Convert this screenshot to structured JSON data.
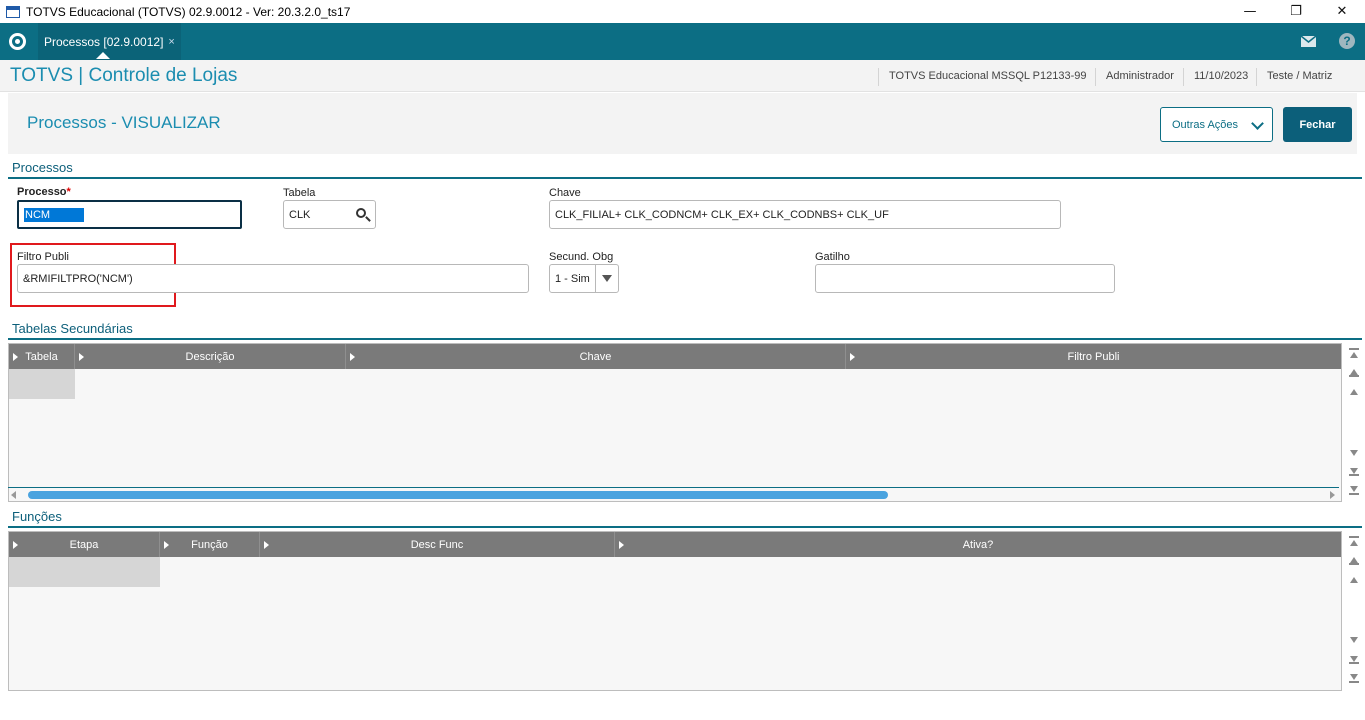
{
  "window": {
    "title": "TOTVS Educacional (TOTVS) 02.9.0012 - Ver: 20.3.2.0_ts17",
    "minimize": "—",
    "restore": "❐",
    "close": "✕"
  },
  "tabbar": {
    "tab_label": "Processos [02.9.0012]",
    "tab_close": "×",
    "help": "?"
  },
  "header": {
    "app_title": "TOTVS | Controle de Lojas",
    "environment": "TOTVS Educacional MSSQL P12133-99",
    "user": "Administrador",
    "date": "11/10/2023",
    "branch": "Teste / Matriz"
  },
  "page": {
    "title": "Processos - VISUALIZAR",
    "outras_acoes_label": "Outras Ações",
    "fechar_label": "Fechar"
  },
  "processos": {
    "section_title": "Processos",
    "processo_label": "Processo",
    "processo_required": "*",
    "processo_value": "NCM",
    "tabela_label": "Tabela",
    "tabela_value": "CLK",
    "chave_label": "Chave",
    "chave_value": "CLK_FILIAL+ CLK_CODNCM+ CLK_EX+ CLK_CODNBS+ CLK_UF",
    "filtro_label": "Filtro Publi",
    "filtro_value": "&RMIFILTPRO('NCM')",
    "secund_label": "Secund. Obg",
    "secund_value": "1 - Sim",
    "gatilho_label": "Gatilho",
    "gatilho_value": ""
  },
  "tabelas_secundarias": {
    "section_title": "Tabelas Secundárias",
    "columns": [
      "Tabela",
      "Descrição",
      "Chave",
      "Filtro Publi"
    ]
  },
  "funcoes": {
    "section_title": "Funções",
    "columns": [
      "Etapa",
      "Função",
      "Desc Func",
      "Ativa?"
    ]
  },
  "colors": {
    "accent": "#0c6e84",
    "title_blue": "#1b8db0",
    "highlight_red": "#e0191d",
    "grid_header": "#7a7a7a"
  }
}
